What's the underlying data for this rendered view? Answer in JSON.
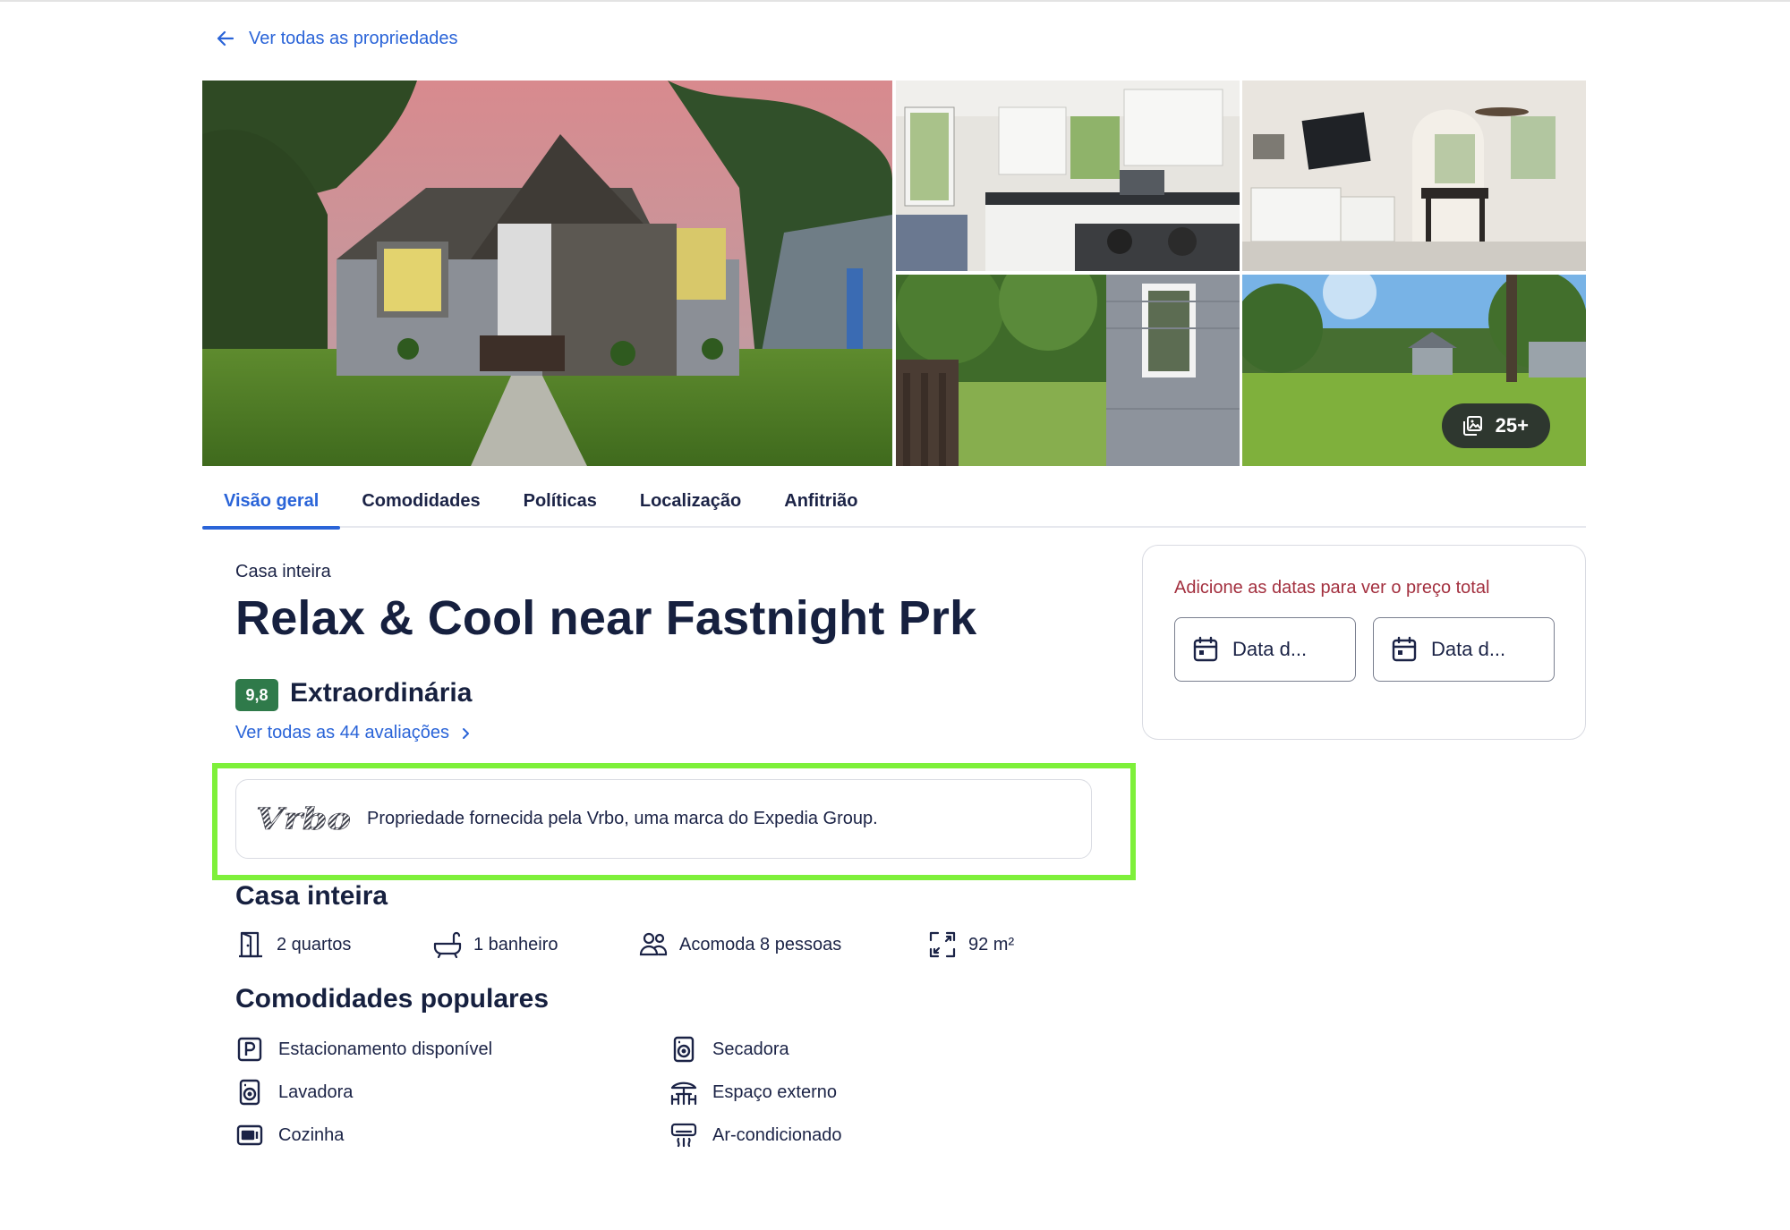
{
  "nav": {
    "back_label": "Ver todas as propriedades"
  },
  "gallery": {
    "photos": [
      {
        "name": "Foto da fachada da casa"
      },
      {
        "name": "Foto da cozinha"
      },
      {
        "name": "Foto da sala de estar"
      },
      {
        "name": "Foto do quintal lateral"
      },
      {
        "name": "Foto do gramado"
      }
    ],
    "photo_count_label": "25+"
  },
  "tabs": [
    {
      "label": "Visão geral",
      "active": true
    },
    {
      "label": "Comodidades",
      "active": false
    },
    {
      "label": "Políticas",
      "active": false
    },
    {
      "label": "Localização",
      "active": false
    },
    {
      "label": "Anfitrião",
      "active": false
    }
  ],
  "property": {
    "type": "Casa inteira",
    "title": "Relax & Cool near Fastnight Prk",
    "rating_score": "9,8",
    "rating_label": "Extraordinária",
    "reviews_link": "Ver todas as 44 avaliações"
  },
  "provider": {
    "logo_text": "Vrbo",
    "text": "Propriedade fornecida pela Vrbo, uma marca do Expedia Group."
  },
  "summary": {
    "title": "Casa inteira",
    "facts": [
      {
        "icon": "door-icon",
        "label": "2 quartos"
      },
      {
        "icon": "bathtub-icon",
        "label": "1 banheiro"
      },
      {
        "icon": "people-icon",
        "label": "Acomoda 8 pessoas"
      },
      {
        "icon": "expand-arrows-icon",
        "label": "92 m²"
      }
    ]
  },
  "amenities": {
    "title": "Comodidades populares",
    "items": [
      {
        "icon": "parking-icon",
        "label": "Estacionamento disponível"
      },
      {
        "icon": "washer-icon",
        "label": "Lavadora"
      },
      {
        "icon": "kitchen-icon",
        "label": "Cozinha"
      },
      {
        "icon": "dryer-icon",
        "label": "Secadora"
      },
      {
        "icon": "outdoor-space-icon",
        "label": "Espaço externo"
      },
      {
        "icon": "air-conditioning-icon",
        "label": "Ar-condicionado"
      }
    ]
  },
  "booking": {
    "hint": "Adicione as datas para ver o preço total",
    "start_label": "Data d...",
    "end_label": "Data d..."
  },
  "colors": {
    "link_blue": "#2a64d8",
    "navy_text": "#1b2346",
    "rating_green": "#2f7a4a",
    "highlight_green": "#7ef03a",
    "hint_red": "#a3303f"
  }
}
